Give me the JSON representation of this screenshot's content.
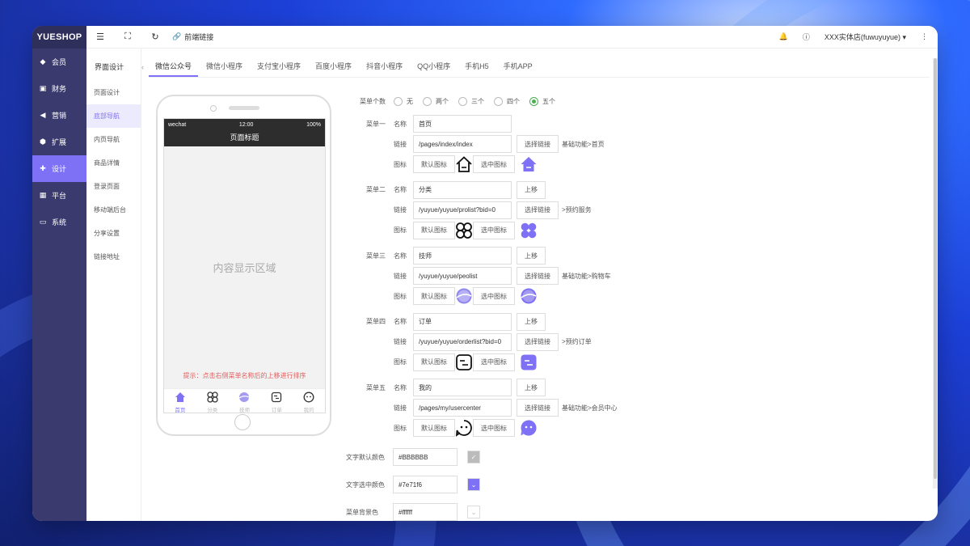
{
  "app": {
    "brand": "YUESHOP"
  },
  "sidebar": {
    "items": [
      {
        "label": "会员",
        "icon": "diamond-icon"
      },
      {
        "label": "财务",
        "icon": "wallet-icon"
      },
      {
        "label": "营销",
        "icon": "megaphone-icon"
      },
      {
        "label": "扩展",
        "icon": "cube-icon"
      },
      {
        "label": "设计",
        "icon": "puzzle-icon",
        "active": true
      },
      {
        "label": "平台",
        "icon": "grid-icon"
      },
      {
        "label": "系统",
        "icon": "monitor-icon"
      }
    ]
  },
  "topbar": {
    "front_link": "前端链接",
    "store_user": "XXX实体店(fuwuyuyue)"
  },
  "subnav": {
    "title": "界面设计",
    "items": [
      "页面设计",
      "底部导航",
      "内页导航",
      "商品详情",
      "登录页面",
      "移动端后台",
      "分享设置",
      "链接地址"
    ],
    "active_index": 1
  },
  "tabs": [
    "微信公众号",
    "微信小程序",
    "支付宝小程序",
    "百度小程序",
    "抖音小程序",
    "QQ小程序",
    "手机H5",
    "手机APP"
  ],
  "phone": {
    "carrier": "wechat",
    "time": "12:00",
    "battery": "100%",
    "page_title": "页面标题",
    "content_placeholder": "内容显示区域",
    "hint": "提示：点击右侧菜单名称后的上移进行排序",
    "tabbar": [
      "首页",
      "分类",
      "技师",
      "订单",
      "我的"
    ]
  },
  "form": {
    "menu_count_label": "菜单个数",
    "menu_count_options": [
      "无",
      "两个",
      "三个",
      "四个",
      "五个"
    ],
    "menu_count_selected": 4,
    "name_label": "名称",
    "link_label": "链接",
    "icon_label": "图标",
    "select_link": "选择链接",
    "move_up": "上移",
    "default_icon": "默认图标",
    "selected_icon": "选中图标",
    "menus": [
      {
        "label": "菜单一",
        "name": "首页",
        "link": "/pages/index/index",
        "link_note": "基础功能>首页",
        "icon": "home-icon"
      },
      {
        "label": "菜单二",
        "name": "分类",
        "link": "/yuyue/yuyue/prolist?bid=0",
        "link_note": ">预约服务",
        "icon": "clover-icon"
      },
      {
        "label": "菜单三",
        "name": "技师",
        "link": "/yuyue/yuyue/peolist",
        "link_note": "基础功能>购物车",
        "icon": "planet-icon"
      },
      {
        "label": "菜单四",
        "name": "订单",
        "link": "/yuyue/yuyue/orderlist?bid=0",
        "link_note": ">预约订单",
        "icon": "order-icon"
      },
      {
        "label": "菜单五",
        "name": "我的",
        "link": "/pages/my/usercenter",
        "link_note": "基础功能>会员中心",
        "icon": "face-icon"
      }
    ],
    "text_default_color_label": "文字默认颜色",
    "text_default_color": "#BBBBBB",
    "text_selected_color_label": "文字选中颜色",
    "text_selected_color": "#7e71f6",
    "menu_bg_color_label": "菜单背景色",
    "menu_bg_color": "#ffffff"
  },
  "colors": {
    "accent": "#7e71f6",
    "sidebar": "#3a3a6e",
    "hint": "#e06060",
    "radio": "#4caf50"
  }
}
